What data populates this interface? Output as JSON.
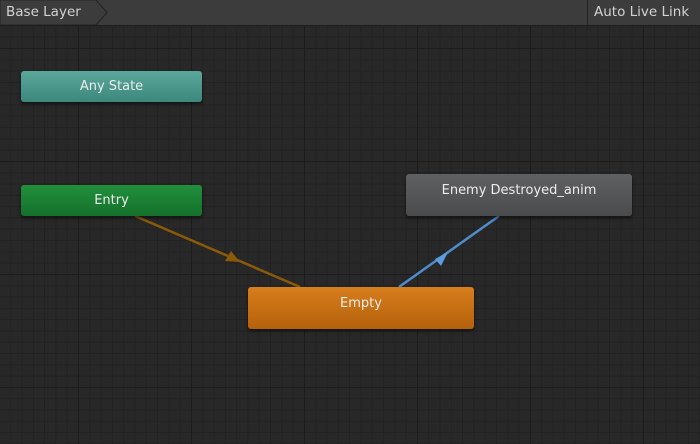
{
  "toolbar": {
    "breadcrumb_label": "Base Layer",
    "auto_live_link_label": "Auto Live Link"
  },
  "graph": {
    "states": {
      "any_state": "Any State",
      "entry": "Entry",
      "enemy_destroyed": "Enemy Destroyed_anim",
      "empty": "Empty"
    },
    "colors": {
      "background": "#282828",
      "any_state": "#4a978c",
      "entry": "#1b8334",
      "enemy_destroyed": "#555658",
      "empty": "#c87016",
      "entry_transition": "#8a5a08",
      "state_transition": "#4f8ccc"
    }
  }
}
